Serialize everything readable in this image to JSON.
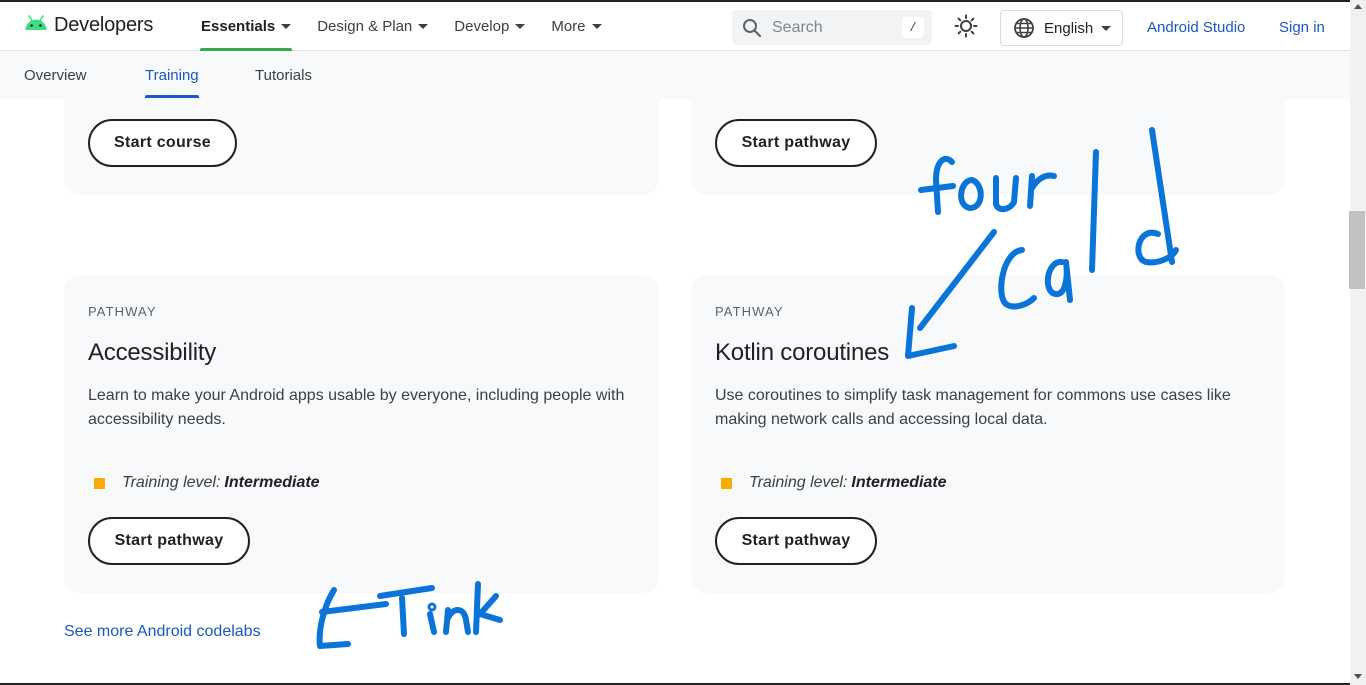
{
  "header": {
    "logo_text": "Developers",
    "nav": [
      {
        "label": "Essentials",
        "active": true
      },
      {
        "label": "Design & Plan",
        "active": false
      },
      {
        "label": "Develop",
        "active": false
      },
      {
        "label": "More",
        "active": false
      }
    ],
    "search": {
      "placeholder": "Search",
      "shortcut": "/"
    },
    "language": "English",
    "android_studio": "Android Studio",
    "sign_in": "Sign in"
  },
  "subnav": {
    "items": [
      {
        "label": "Overview",
        "active": false
      },
      {
        "label": "Training",
        "active": true
      },
      {
        "label": "Tutorials",
        "active": false
      }
    ]
  },
  "cards_top": {
    "left_button": "Start course",
    "right_button": "Start pathway"
  },
  "cards": [
    {
      "kicker": "PATHWAY",
      "title": "Accessibility",
      "description": "Learn to make your Android apps usable by everyone, including people with accessibility needs.",
      "level_label": "Training level:",
      "level_value": "Intermediate",
      "button": "Start pathway"
    },
    {
      "kicker": "PATHWAY",
      "title": "Kotlin coroutines",
      "description": "Use coroutines to simplify task management for commons use cases like making network calls and accessing local data.",
      "level_label": "Training level:",
      "level_value": "Intermediate",
      "button": "Start pathway"
    }
  ],
  "more_link": "See more Android codelabs",
  "annotations": [
    "four",
    "Cald",
    "Tink"
  ],
  "colors": {
    "link_blue": "#1a57c7",
    "active_green": "#34a853",
    "level_orange": "#f9ab00",
    "ink_blue": "#0a74d8",
    "android_green": "#3ddc84"
  }
}
